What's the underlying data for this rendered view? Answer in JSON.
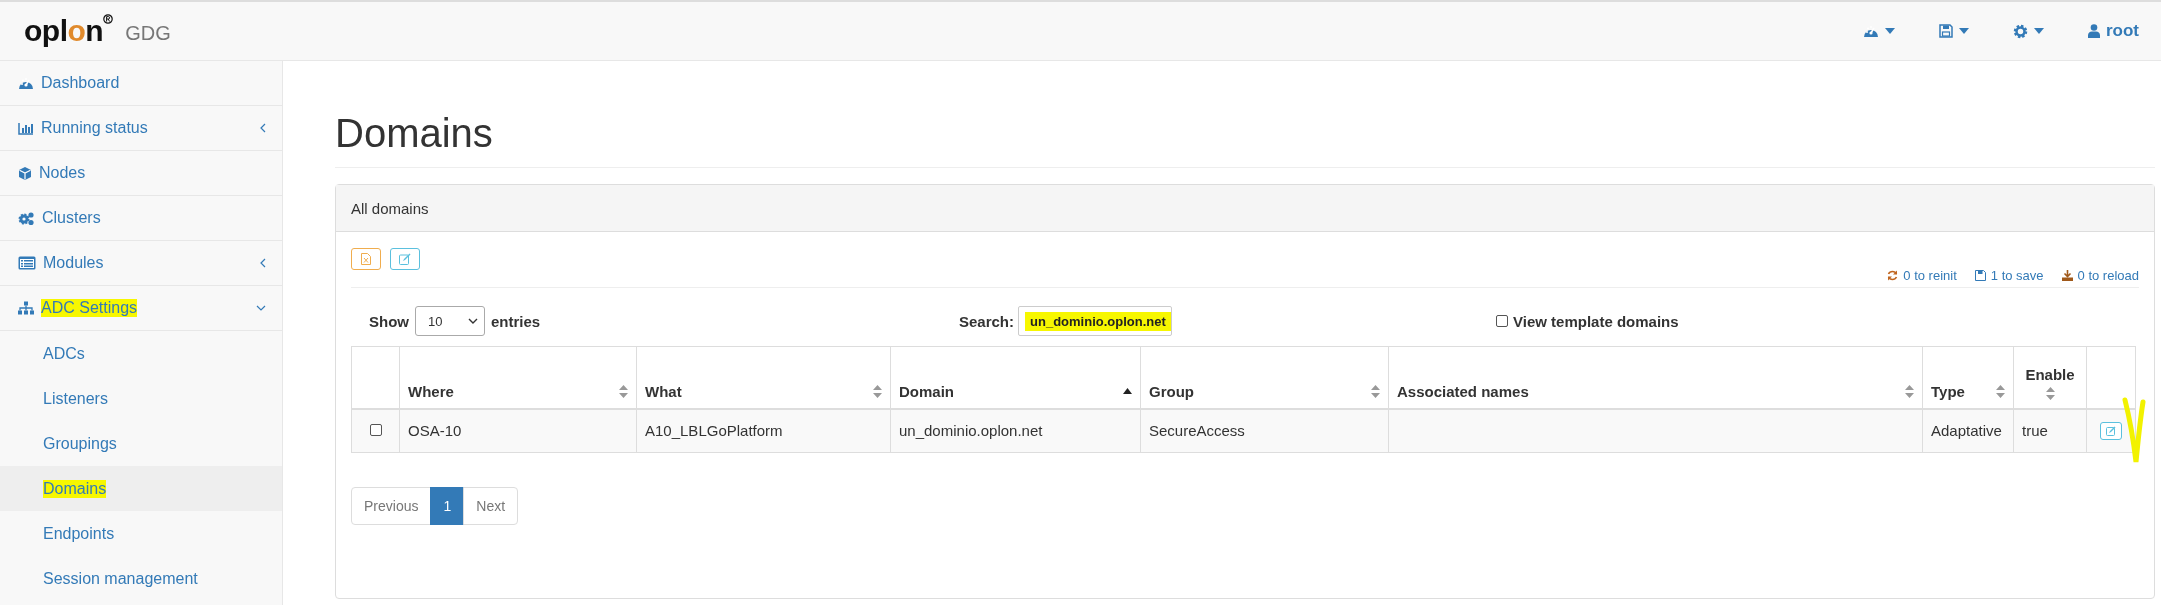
{
  "brand": {
    "logo": "oplon",
    "product": "GDG"
  },
  "topbar": {
    "user": "root"
  },
  "sidebar": {
    "items": [
      {
        "label": "Dashboard"
      },
      {
        "label": "Running status",
        "expanded": false
      },
      {
        "label": "Nodes"
      },
      {
        "label": "Clusters"
      },
      {
        "label": "Modules",
        "expanded": false
      },
      {
        "label": "ADC Settings",
        "expanded": true,
        "highlighted": true,
        "children": [
          {
            "label": "ADCs",
            "selected": false,
            "highlighted": false
          },
          {
            "label": "Listeners",
            "selected": false,
            "highlighted": false
          },
          {
            "label": "Groupings",
            "selected": false,
            "highlighted": false
          },
          {
            "label": "Domains",
            "selected": true,
            "highlighted": true
          },
          {
            "label": "Endpoints",
            "selected": false,
            "highlighted": false
          },
          {
            "label": "Session management",
            "selected": false,
            "highlighted": false
          }
        ]
      }
    ]
  },
  "page": {
    "title": "Domains"
  },
  "panel": {
    "title": "All domains",
    "status": [
      "0 to reinit",
      "1 to save",
      "0 to reload"
    ],
    "length": {
      "label_before": "Show",
      "value": "10",
      "label_after": "entries"
    },
    "search": {
      "label": "Search:",
      "value": "un_dominio.oplon.net",
      "highlighted": true
    },
    "template_toggle": {
      "label": "View template domains",
      "checked": false
    },
    "table": {
      "columns": [
        {
          "label": "Where",
          "sorted": false
        },
        {
          "label": "What",
          "sorted": false
        },
        {
          "label": "Domain",
          "sorted": true
        },
        {
          "label": "Group",
          "sorted": false
        },
        {
          "label": "Associated names",
          "sorted": false
        },
        {
          "label": "Type",
          "sorted": false
        },
        {
          "label": "Enable",
          "sorted": false
        }
      ],
      "rows": [
        {
          "checked": false,
          "cells": [
            "OSA-10",
            "A10_LBLGoPlatform",
            "un_dominio.oplon.net",
            "SecureAccess",
            "",
            "Adaptative",
            "true"
          ],
          "action_marked": true
        }
      ]
    },
    "pagination": [
      {
        "label": "Previous",
        "selected": false,
        "disabled": true
      },
      {
        "label": "1",
        "selected": true,
        "disabled": false
      },
      {
        "label": "Next",
        "selected": false,
        "disabled": true
      }
    ]
  }
}
